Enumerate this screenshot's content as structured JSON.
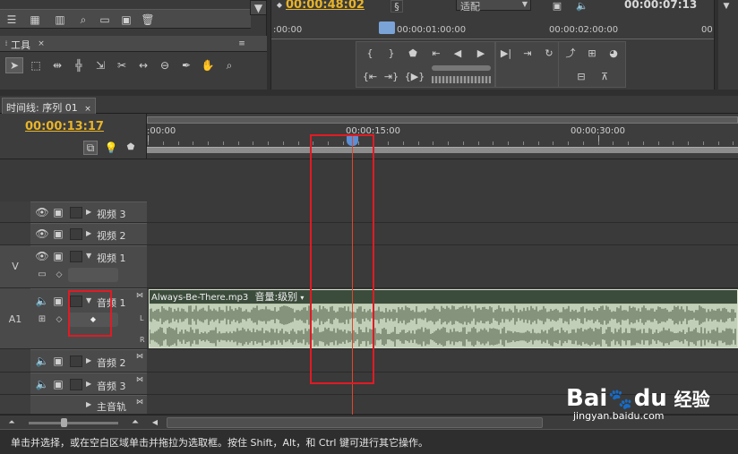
{
  "top_left": {
    "tools_tab_label": "工具"
  },
  "monitor": {
    "timecode_current": "00:00:48:02",
    "fit_label": "适配",
    "timecode_duration": "00:00:07:13",
    "ruler_labels": [
      ":00:00",
      "00:00:01:00:00",
      "00:00:02:00:00",
      "00"
    ]
  },
  "timeline": {
    "tab_label": "时间线: 序列 01",
    "timecode": "00:00:13:17",
    "ruler_ticks": [
      ":00:00",
      "00:00:15:00",
      "00:00:30:00"
    ],
    "tracks": [
      {
        "name": "视频 3"
      },
      {
        "name": "视频 2"
      },
      {
        "name": "视频 1",
        "target": "V"
      },
      {
        "name": "音频 1",
        "target": "A1"
      },
      {
        "name": "音频 2"
      },
      {
        "name": "音频 3"
      },
      {
        "name": "主音轨"
      }
    ],
    "clip": {
      "name": "Always-Be-There.mp3",
      "property": "音量:级别",
      "channel_left": "L",
      "channel_right": "R"
    }
  },
  "status_bar": {
    "text": "单击并选择，或在空白区域单击并拖拉为选取框。按住 Shift，Alt，和 Ctrl 键可进行其它操作。"
  },
  "watermark": {
    "brand": "Bai",
    "brand2": "du",
    "suffix": "经验",
    "url": "jingyan.baidu.com"
  },
  "colors": {
    "timecode": "#e8b429",
    "playhead": "#e0452c",
    "annotation": "#e01b24",
    "clip": "#b4c4a8"
  }
}
